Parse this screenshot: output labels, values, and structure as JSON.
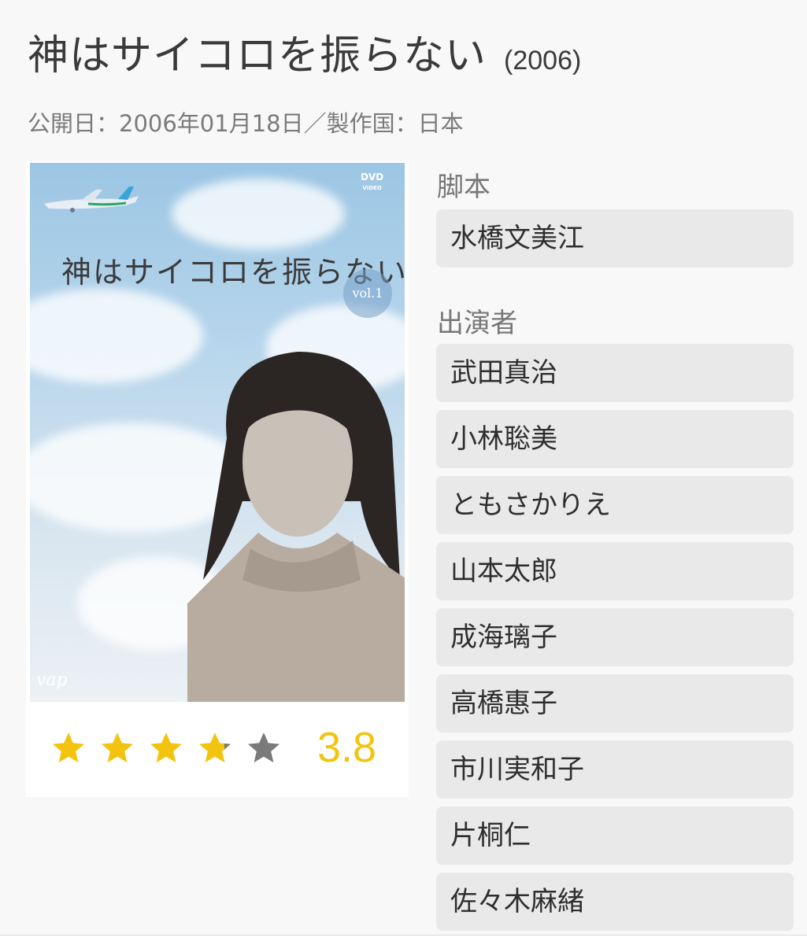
{
  "movie": {
    "title": "神はサイコロを振らない",
    "year": "(2006)",
    "release_label": "公開日：2006年01月18日",
    "separator": "／",
    "country_label": "製作国：日本"
  },
  "poster": {
    "title": "神はサイコロを振らない",
    "vol": "vol.1",
    "dvd_logo": "DVD",
    "dvd_sub": "VIDEO",
    "publisher_logo": "vap"
  },
  "rating": {
    "value": "3.8",
    "score": 3.8,
    "max": 5,
    "star_color": "#f2c40f",
    "empty_color": "#7a7a7a"
  },
  "writer": {
    "label": "脚本",
    "names": [
      "水橋文美江"
    ]
  },
  "cast": {
    "label": "出演者",
    "names": [
      "武田真治",
      "小林聡美",
      "ともさかりえ",
      "山本太郎",
      "成海璃子",
      "高橋惠子",
      "市川実和子",
      "片桐仁",
      "佐々木麻緒"
    ]
  }
}
